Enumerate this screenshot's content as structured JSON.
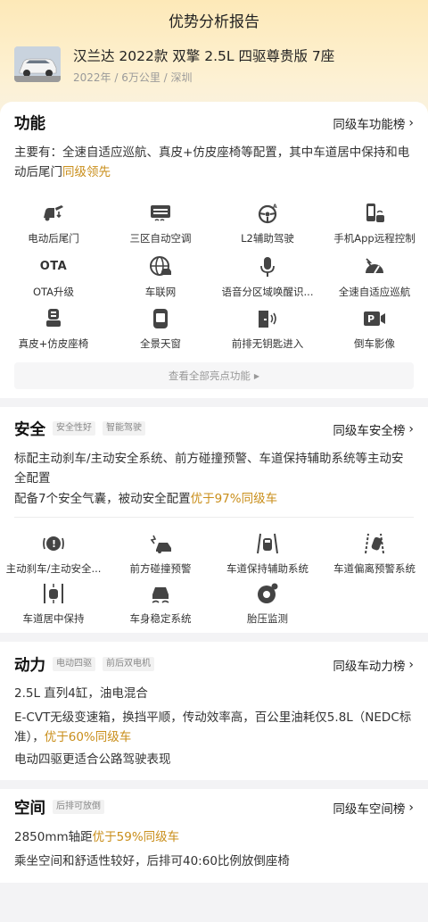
{
  "page_title": "优势分析报告",
  "car": {
    "name": "汉兰达 2022款 双擎 2.5L 四驱尊贵版 7座",
    "meta": "2022年 / 6万公里 / 深圳"
  },
  "function": {
    "title": "功能",
    "rank_link": "同级车功能榜",
    "desc_prefix": "主要有：全速自适应巡航、真皮+仿皮座椅等配置，其中车道居中保持和电动后尾门",
    "desc_highlight": "同级领先",
    "features": [
      {
        "label": "电动后尾门",
        "icon": "tailgate-icon"
      },
      {
        "label": "三区自动空调",
        "icon": "air-conditioner-icon"
      },
      {
        "label": "L2辅助驾驶",
        "icon": "steering-assist-icon"
      },
      {
        "label": "手机App远程控制",
        "icon": "phone-remote-icon"
      },
      {
        "label": "OTA升级",
        "icon": "ota-icon",
        "text": "OTA"
      },
      {
        "label": "车联网",
        "icon": "connected-car-icon"
      },
      {
        "label": "语音分区域唤醒识...",
        "icon": "microphone-icon"
      },
      {
        "label": "全速自适应巡航",
        "icon": "cruise-control-icon"
      },
      {
        "label": "真皮+仿皮座椅",
        "icon": "seat-icon"
      },
      {
        "label": "全景天窗",
        "icon": "sunroof-icon"
      },
      {
        "label": "前排无钥匙进入",
        "icon": "keyless-entry-icon"
      },
      {
        "label": "倒车影像",
        "icon": "reverse-camera-icon"
      }
    ],
    "view_all": "查看全部亮点功能"
  },
  "safety": {
    "title": "安全",
    "tags": [
      "安全性好",
      "智能驾驶"
    ],
    "rank_link": "同级车安全榜",
    "desc1": "标配主动刹车/主动安全系统、前方碰撞预警、车道保持辅助系统等主动安全配置",
    "desc2_prefix": "配备7个安全气囊，被动安全配置",
    "desc2_highlight": "优于97%同级车",
    "features": [
      {
        "label": "主动刹车/主动安全...",
        "icon": "active-brake-icon"
      },
      {
        "label": "前方碰撞预警",
        "icon": "collision-warning-icon"
      },
      {
        "label": "车道保持辅助系统",
        "icon": "lane-keep-icon"
      },
      {
        "label": "车道偏离预警系统",
        "icon": "lane-departure-icon"
      },
      {
        "label": "车道居中保持",
        "icon": "lane-center-icon"
      },
      {
        "label": "车身稳定系统",
        "icon": "stability-control-icon"
      },
      {
        "label": "胎压监测",
        "icon": "tire-pressure-icon"
      }
    ]
  },
  "power": {
    "title": "动力",
    "tags": [
      "电动四驱",
      "前后双电机"
    ],
    "rank_link": "同级车动力榜",
    "line1": "2.5L 直列4缸，油电混合",
    "line2_prefix": "E-CVT无级变速箱，换挡平顺，传动效率高，百公里油耗仅5.8L（NEDC标准），",
    "line2_highlight": "优于60%同级车",
    "line3": "电动四驱更适合公路驾驶表现"
  },
  "space": {
    "title": "空间",
    "tags": [
      "后排可放倒"
    ],
    "rank_link": "同级车空间榜",
    "line1_prefix": "2850mm轴距",
    "line1_highlight": "优于59%同级车",
    "line2": "乘坐空间和舒适性较好，后排可40:60比例放倒座椅"
  },
  "colors": {
    "accent": "#c98e1a",
    "header_bg": "#fde9b8"
  }
}
